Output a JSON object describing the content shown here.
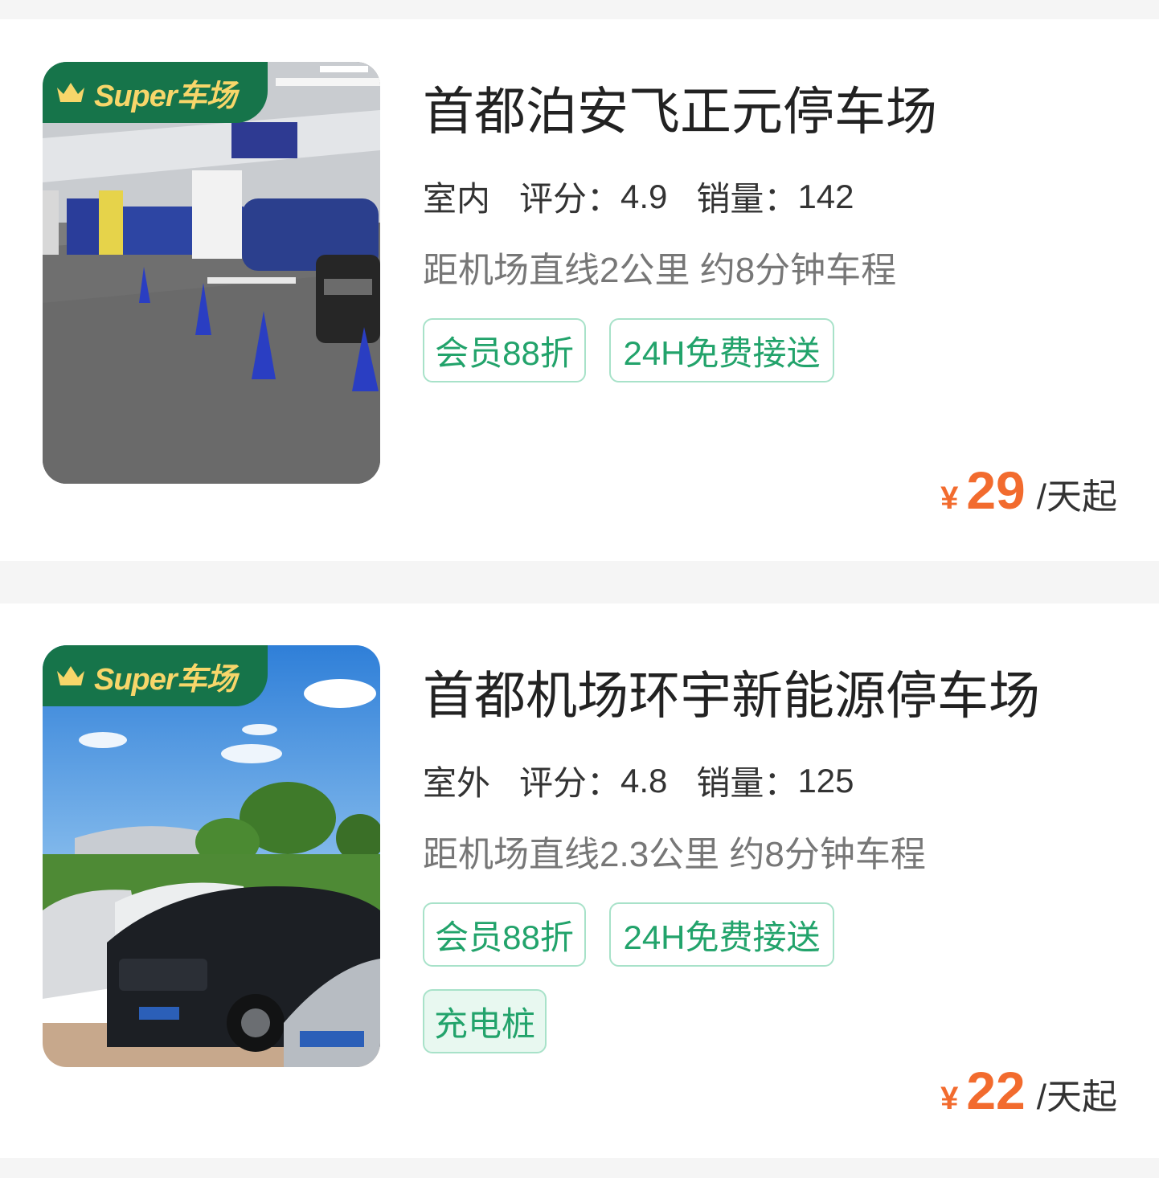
{
  "listings": [
    {
      "badge": "Super车场",
      "name": "首都泊安飞正元停车场",
      "type": "室内",
      "rating_label": "评分：",
      "rating": "4.9",
      "sales_label": "销量：",
      "sales": "142",
      "distance": "距机场直线2公里 约8分钟车程",
      "tags": [
        "会员88折",
        "24H免费接送"
      ],
      "currency": "¥",
      "price": "29",
      "unit": "/天起",
      "photo": "indoor-garage-photo"
    },
    {
      "badge": "Super车场",
      "name": "首都机场环宇新能源停车场",
      "type": "室外",
      "rating_label": "评分：",
      "rating": "4.8",
      "sales_label": "销量：",
      "sales": "125",
      "distance": "距机场直线2.3公里 约8分钟车程",
      "tags": [
        "会员88折",
        "24H免费接送",
        "充电桩"
      ],
      "currency": "¥",
      "price": "22",
      "unit": "/天起",
      "photo": "outdoor-lot-photo"
    }
  ],
  "colors": {
    "accent_green": "#22a36b",
    "badge_green": "#16744a",
    "badge_text": "#f7d66a",
    "price_orange": "#f26b2e"
  }
}
